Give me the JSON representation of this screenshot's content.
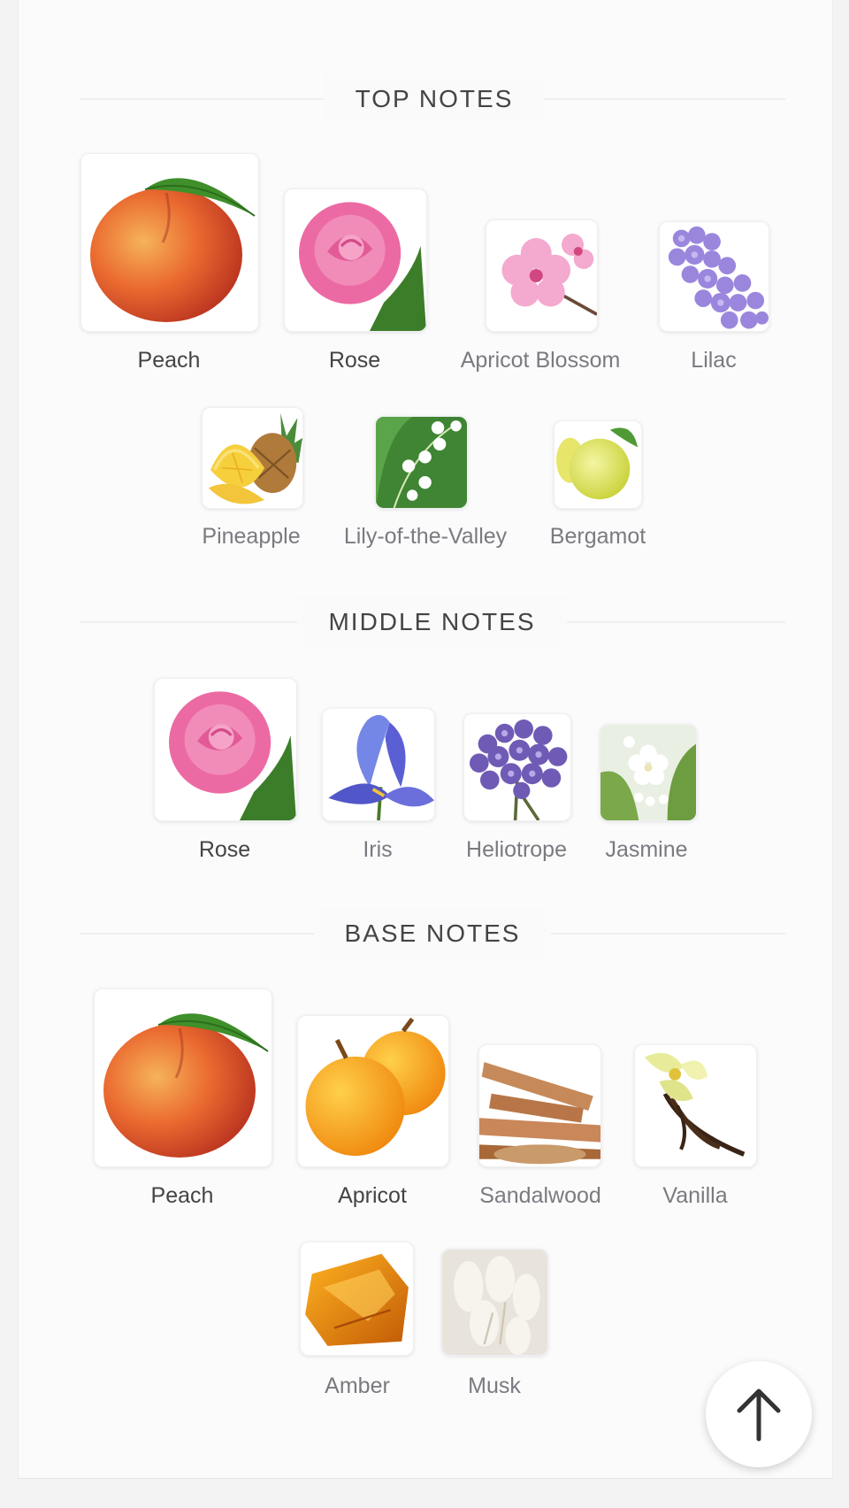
{
  "sections": [
    {
      "title": "TOP NOTES",
      "notes": [
        {
          "label": "Peach",
          "icon": "peach-icon"
        },
        {
          "label": "Rose",
          "icon": "rose-icon"
        },
        {
          "label": "Apricot Blossom",
          "icon": "apricot-blossom-icon"
        },
        {
          "label": "Lilac",
          "icon": "lilac-icon"
        },
        {
          "label": "Pineapple",
          "icon": "pineapple-icon"
        },
        {
          "label": "Lily-of-the-Valley",
          "icon": "lily-of-the-valley-icon"
        },
        {
          "label": "Bergamot",
          "icon": "bergamot-icon"
        }
      ]
    },
    {
      "title": "MIDDLE NOTES",
      "notes": [
        {
          "label": "Rose",
          "icon": "rose-icon"
        },
        {
          "label": "Iris",
          "icon": "iris-icon"
        },
        {
          "label": "Heliotrope",
          "icon": "heliotrope-icon"
        },
        {
          "label": "Jasmine",
          "icon": "jasmine-icon"
        }
      ]
    },
    {
      "title": "BASE NOTES",
      "notes": [
        {
          "label": "Peach",
          "icon": "peach-icon"
        },
        {
          "label": "Apricot",
          "icon": "apricot-icon"
        },
        {
          "label": "Sandalwood",
          "icon": "sandalwood-icon"
        },
        {
          "label": "Vanilla",
          "icon": "vanilla-icon"
        },
        {
          "label": "Amber",
          "icon": "amber-icon"
        },
        {
          "label": "Musk",
          "icon": "musk-icon"
        }
      ]
    }
  ],
  "scroll_top_icon": "arrow-up-icon",
  "colors": {
    "background": "#fbfbfc",
    "title_text": "#444444",
    "label_text": "#555555"
  }
}
